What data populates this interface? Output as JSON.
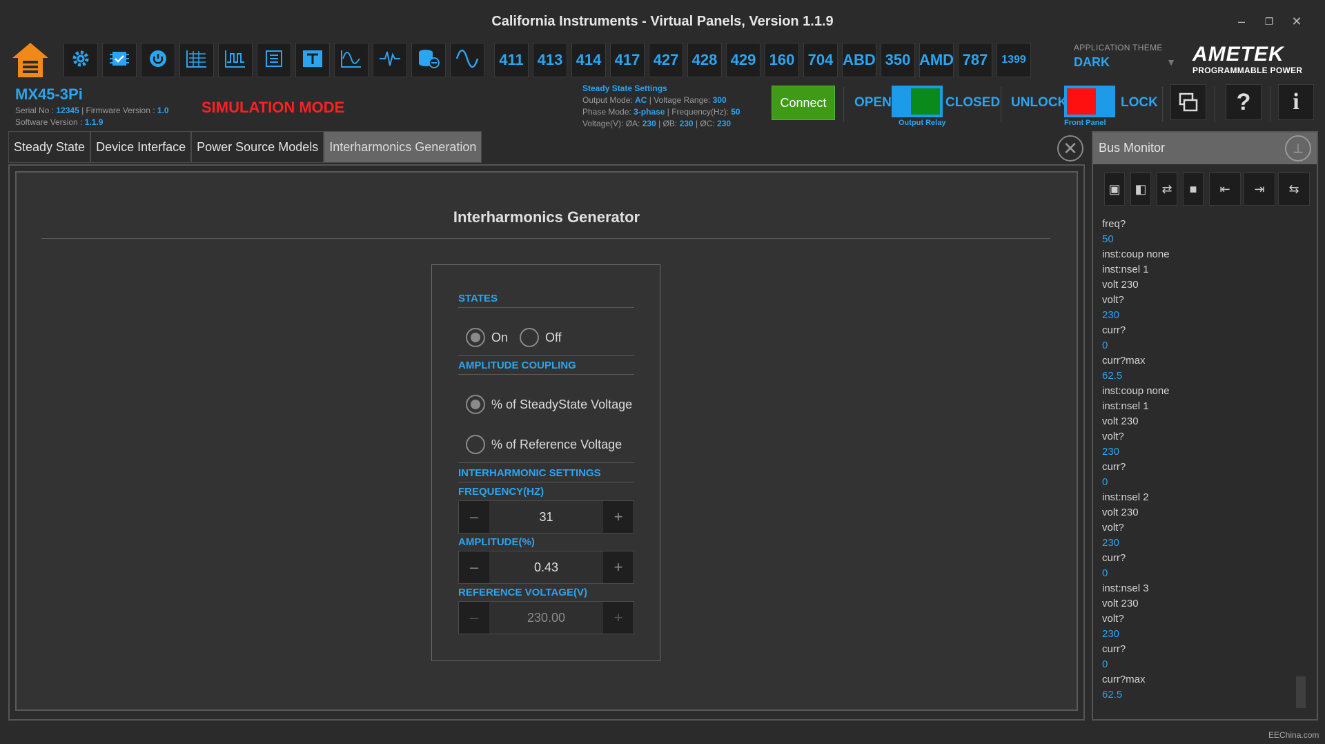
{
  "window": {
    "title": "California Instruments - Virtual Panels, Version 1.1.9",
    "minimize_label": "–",
    "restore_label": "❐",
    "close_label": "✕"
  },
  "toolbar": {
    "icon_buttons": [
      "settings-icon",
      "chip-icon",
      "power-icon",
      "waveform-table-icon",
      "step-waveform-icon",
      "list-icon",
      "transient-icon",
      "harmonics-icon",
      "pulse-icon",
      "database-icon",
      "sine-wave-icon"
    ],
    "number_buttons": [
      "411",
      "413",
      "414",
      "417",
      "427",
      "428",
      "429",
      "160",
      "704",
      "ABD",
      "350",
      "AMD",
      "787",
      "1399"
    ]
  },
  "theme": {
    "label": "APPLICATION THEME",
    "value": "DARK"
  },
  "brand": {
    "name": "AMETEK",
    "subtitle": "PROGRAMMABLE POWER"
  },
  "device": {
    "model": "MX45-3Pi",
    "serial_label": "Serial No :",
    "serial_value": "12345",
    "firmware_label": "Firmware Version :",
    "firmware_value": "1.0",
    "software_label": "Software Version :",
    "software_value": "1.1.9",
    "mode_badge": "SIMULATION MODE"
  },
  "steady_state": {
    "title": "Steady State Settings",
    "output_mode_label": "Output Mode:",
    "output_mode": "AC",
    "voltage_range_label": "Voltage Range:",
    "voltage_range": "300",
    "phase_mode_label": "Phase Mode:",
    "phase_mode": "3-phase",
    "frequency_label": "Frequency(Hz):",
    "frequency": "50",
    "voltage_label": "Voltage(V): ØA:",
    "va": "230",
    "vb_label": "ØB:",
    "vb": "230",
    "vc_label": "ØC:",
    "vc": "230"
  },
  "connection": {
    "connect_label": "Connect"
  },
  "output_relay": {
    "open_label": "OPEN",
    "closed_label": "CLOSED",
    "caption": "Output Relay",
    "state_color": "#0a8a1a"
  },
  "front_panel": {
    "unlock_label": "UNLOCK",
    "lock_label": "LOCK",
    "caption": "Front Panel",
    "state_color": "#ff1010"
  },
  "tabs": [
    "Steady State",
    "Device Interface",
    "Power Source Models",
    "Interharmonics Generation"
  ],
  "active_tab": "Interharmonics Generation",
  "generator": {
    "title": "Interharmonics Generator",
    "states_heading": "STATES",
    "state_on": "On",
    "state_off": "Off",
    "state_selected": "On",
    "coupling_heading": "AMPLITUDE COUPLING",
    "coupling_steady": "% of SteadyState Voltage",
    "coupling_reference": "% of Reference Voltage",
    "coupling_selected": "% of SteadyState Voltage",
    "settings_heading": "INTERHARMONIC SETTINGS",
    "frequency_label": "FREQUENCY(HZ)",
    "frequency_value": "31",
    "amplitude_label": "AMPLITUDE(%)",
    "amplitude_value": "0.43",
    "reference_label": "REFERENCE VOLTAGE(V)",
    "reference_value": "230.00",
    "minus": "–",
    "plus": "+"
  },
  "bus_monitor": {
    "title": "Bus Monitor",
    "tools": [
      "dock-right-icon",
      "dock-left-icon",
      "swap-icon",
      "stop-icon",
      "save-in-icon",
      "save-to-icon",
      "save-swap-icon"
    ],
    "log": [
      {
        "text": "freq?",
        "kind": "cmd"
      },
      {
        "text": "50",
        "kind": "resp"
      },
      {
        "text": "inst:coup none",
        "kind": "cmd"
      },
      {
        "text": "inst:nsel 1",
        "kind": "cmd"
      },
      {
        "text": "volt 230",
        "kind": "cmd"
      },
      {
        "text": "volt?",
        "kind": "cmd"
      },
      {
        "text": "230",
        "kind": "resp"
      },
      {
        "text": "curr?",
        "kind": "cmd"
      },
      {
        "text": "0",
        "kind": "resp"
      },
      {
        "text": "curr?max",
        "kind": "cmd"
      },
      {
        "text": "62.5",
        "kind": "resp"
      },
      {
        "text": "inst:coup none",
        "kind": "cmd"
      },
      {
        "text": "inst:nsel 1",
        "kind": "cmd"
      },
      {
        "text": "volt 230",
        "kind": "cmd"
      },
      {
        "text": "volt?",
        "kind": "cmd"
      },
      {
        "text": "230",
        "kind": "resp"
      },
      {
        "text": "curr?",
        "kind": "cmd"
      },
      {
        "text": "0",
        "kind": "resp"
      },
      {
        "text": "inst:nsel 2",
        "kind": "cmd"
      },
      {
        "text": "volt 230",
        "kind": "cmd"
      },
      {
        "text": "volt?",
        "kind": "cmd"
      },
      {
        "text": "230",
        "kind": "resp"
      },
      {
        "text": "curr?",
        "kind": "cmd"
      },
      {
        "text": "0",
        "kind": "resp"
      },
      {
        "text": "inst:nsel 3",
        "kind": "cmd"
      },
      {
        "text": "volt 230",
        "kind": "cmd"
      },
      {
        "text": "volt?",
        "kind": "cmd"
      },
      {
        "text": "230",
        "kind": "resp"
      },
      {
        "text": "curr?",
        "kind": "cmd"
      },
      {
        "text": "0",
        "kind": "resp"
      },
      {
        "text": "curr?max",
        "kind": "cmd"
      },
      {
        "text": "62.5",
        "kind": "resp"
      }
    ]
  },
  "footer": {
    "credit": "EEChina.com"
  },
  "colors": {
    "accent": "#2aa5f2",
    "background": "#2b2b2b",
    "alert": "#ff2020",
    "connect": "#3f9b16"
  }
}
